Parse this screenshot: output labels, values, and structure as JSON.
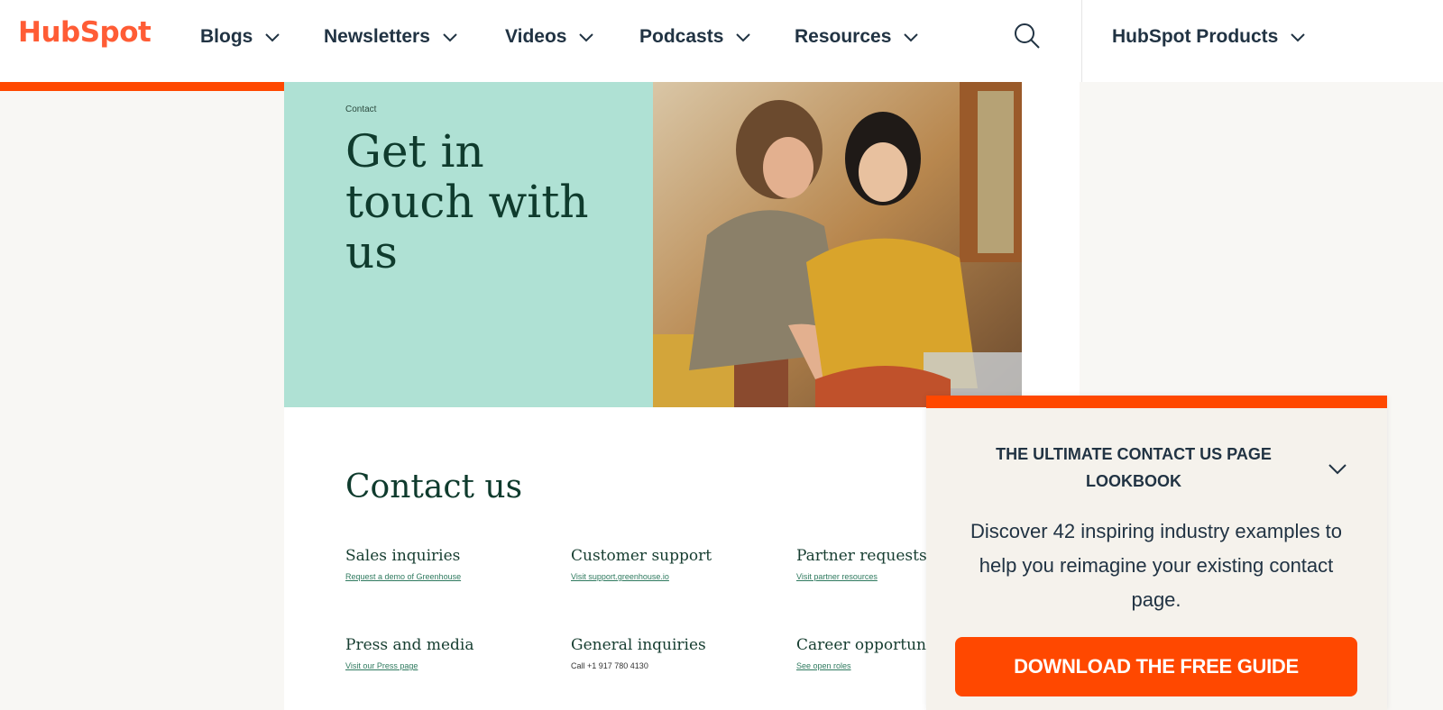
{
  "nav": {
    "logo": "HubSpot",
    "items": [
      {
        "label": "Blogs"
      },
      {
        "label": "Newsletters"
      },
      {
        "label": "Videos"
      },
      {
        "label": "Podcasts"
      },
      {
        "label": "Resources"
      }
    ],
    "products_label": "HubSpot Products",
    "search_icon": "search-icon",
    "scroll_progress": 0.23
  },
  "hero": {
    "breadcrumb": "Contact",
    "title": "Get in touch with us"
  },
  "contact": {
    "section_title": "Contact us",
    "items": [
      {
        "heading": "Sales inquiries",
        "link": "Request a demo of Greenhouse"
      },
      {
        "heading": "Customer support",
        "link": "Visit support.greenhouse.io"
      },
      {
        "heading": "Partner requests",
        "link": "Visit partner resources"
      },
      {
        "heading": "Press and media",
        "link": "Visit our Press page"
      },
      {
        "heading": "General inquiries",
        "text": "Call +1 917 780 4130"
      },
      {
        "heading": "Career opportunit",
        "link": "See open roles"
      }
    ]
  },
  "popup": {
    "title": "THE ULTIMATE CONTACT US PAGE LOOKBOOK",
    "body": "Discover 42 inspiring industry examples to help you reimagine your existing contact page.",
    "cta": "DOWNLOAD THE FREE GUIDE",
    "accent": "#ff4800"
  },
  "colors": {
    "brand": "#ff5c35",
    "mint": "#afe1d4",
    "dark_green": "#0f3b2d",
    "navy": "#213343"
  }
}
